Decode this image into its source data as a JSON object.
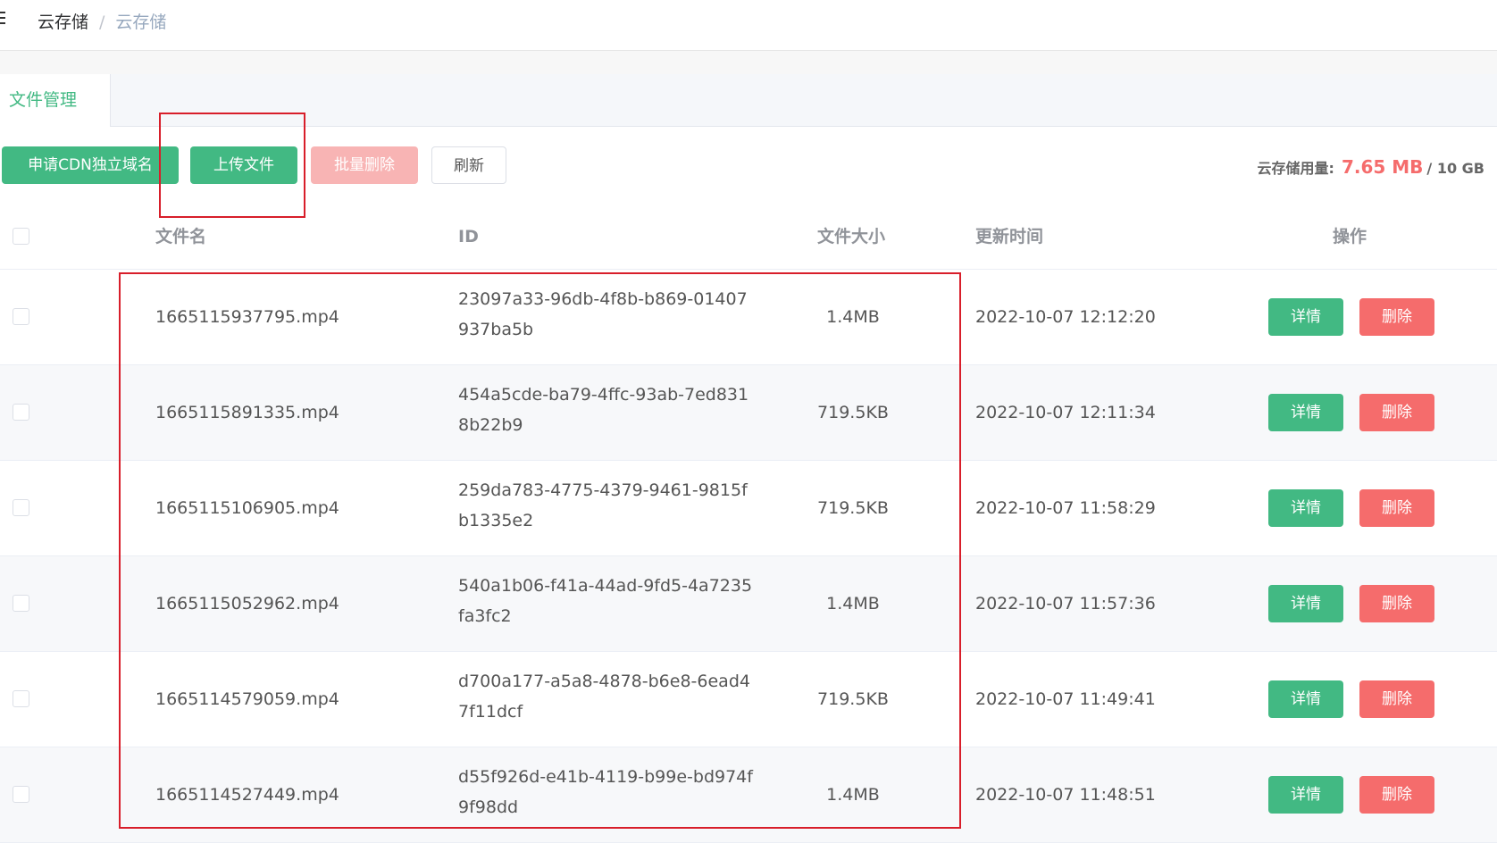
{
  "breadcrumb": [
    "云存储",
    "云存储"
  ],
  "breadcrumb_sep": "/",
  "tab": "文件管理",
  "toolbar": {
    "cdn": "申请CDN独立域名",
    "upload": "上传文件",
    "batch_delete": "批量删除",
    "refresh": "刷新"
  },
  "usage": {
    "label": "云存储用量:",
    "used": "7.65 MB",
    "total": "/ 10 GB"
  },
  "table": {
    "headers": {
      "name": "文件名",
      "id": "ID",
      "size": "文件大小",
      "time": "更新时间",
      "ops": "操作"
    },
    "rows": [
      {
        "name": "1665115937795.mp4",
        "id": "23097a33-96db-4f8b-b869-01407937ba5b",
        "size": "1.4MB",
        "time": "2022-10-07 12:12:20"
      },
      {
        "name": "1665115891335.mp4",
        "id": "454a5cde-ba79-4ffc-93ab-7ed8318b22b9",
        "size": "719.5KB",
        "time": "2022-10-07 12:11:34"
      },
      {
        "name": "1665115106905.mp4",
        "id": "259da783-4775-4379-9461-9815fb1335e2",
        "size": "719.5KB",
        "time": "2022-10-07 11:58:29"
      },
      {
        "name": "1665115052962.mp4",
        "id": "540a1b06-f41a-44ad-9fd5-4a7235fa3fc2",
        "size": "1.4MB",
        "time": "2022-10-07 11:57:36"
      },
      {
        "name": "1665114579059.mp4",
        "id": "d700a177-a5a8-4878-b6e8-6ead47f11dcf",
        "size": "719.5KB",
        "time": "2022-10-07 11:49:41"
      },
      {
        "name": "1665114527449.mp4",
        "id": "d55f926d-e41b-4119-b99e-bd974f9f98dd",
        "size": "1.4MB",
        "time": "2022-10-07 11:48:51"
      }
    ],
    "detail_label": "详情",
    "delete_label": "删除"
  },
  "colors": {
    "primary": "#42b983",
    "danger": "#f56c6c",
    "highlight": "#d81e2a"
  }
}
